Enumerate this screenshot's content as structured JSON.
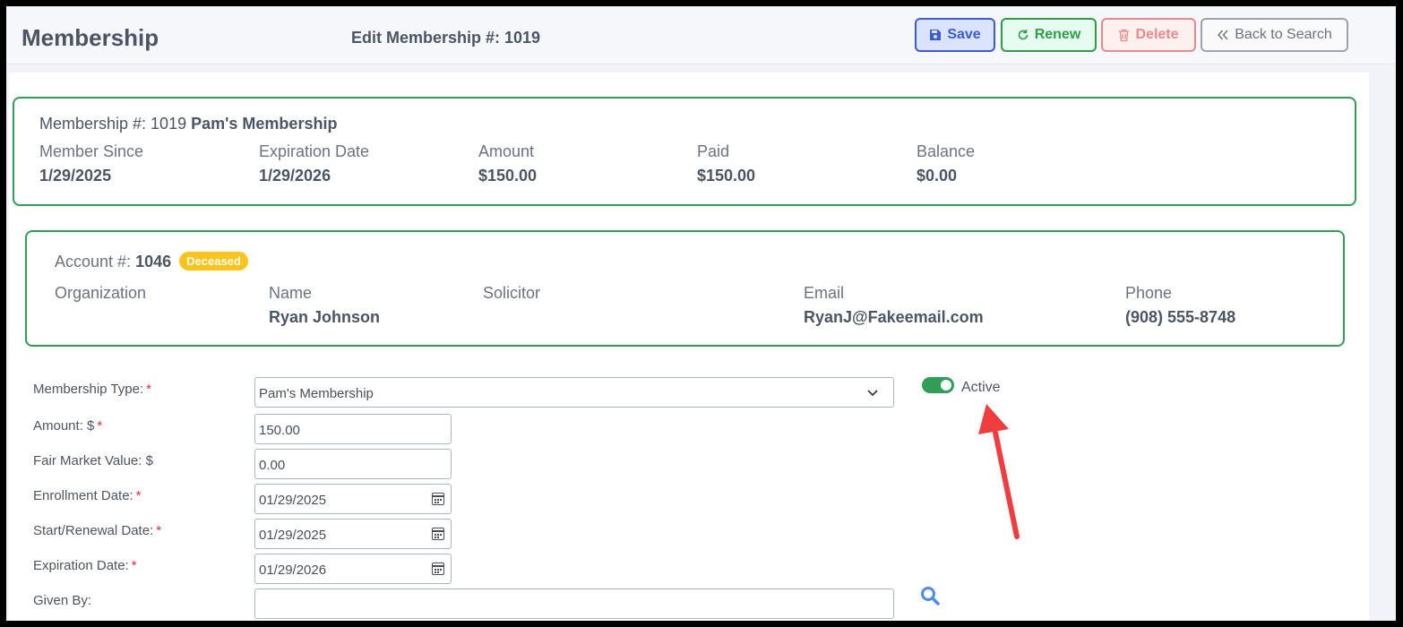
{
  "header": {
    "title": "Membership",
    "edit_title": "Edit Membership #: 1019",
    "buttons": {
      "save": "Save",
      "renew": "Renew",
      "delete": "Delete",
      "back": "Back to Search"
    }
  },
  "membership_card": {
    "prefix": "Membership #: 1019",
    "name": "Pam's Membership",
    "fields": [
      {
        "label": "Member Since",
        "value": "1/29/2025"
      },
      {
        "label": "Expiration Date",
        "value": "1/29/2026"
      },
      {
        "label": "Amount",
        "value": "$150.00"
      },
      {
        "label": "Paid",
        "value": "$150.00"
      },
      {
        "label": "Balance",
        "value": "$0.00"
      }
    ]
  },
  "account_card": {
    "prefix": "Account #:",
    "number": "1046",
    "badge": "Deceased",
    "fields": [
      {
        "label": "Organization",
        "value": ""
      },
      {
        "label": "Name",
        "value": "Ryan Johnson"
      },
      {
        "label": "Solicitor",
        "value": ""
      },
      {
        "label": "Email",
        "value": "RyanJ@Fakeemail.com"
      },
      {
        "label": "Phone",
        "value": "(908) 555-8748"
      }
    ]
  },
  "form": {
    "membership_type": {
      "label": "Membership Type:",
      "value": "Pam's Membership"
    },
    "amount": {
      "label": "Amount: $",
      "value": "150.00"
    },
    "fair_market_value": {
      "label": "Fair Market Value: $",
      "value": "0.00"
    },
    "enrollment_date": {
      "label": "Enrollment Date:",
      "value": "01/29/2025"
    },
    "start_renewal_date": {
      "label": "Start/Renewal Date:",
      "value": "01/29/2025"
    },
    "expiration_date": {
      "label": "Expiration Date:",
      "value": "01/29/2026"
    },
    "given_by": {
      "label": "Given By:",
      "value": ""
    },
    "required_marker": "*",
    "active_label": "Active",
    "active": true
  },
  "colors": {
    "card_border": "#2f9e57",
    "save": "#3b5bdb",
    "renew": "#2f9e44",
    "delete": "#e88a8a",
    "badge": "#fcc419",
    "arrow": "#f03e3e"
  },
  "icons": [
    "save-icon",
    "renew-icon",
    "trash-icon",
    "double-chevron-left-icon",
    "chevron-down-icon",
    "calendar-icon",
    "search-icon",
    "arrow-annotation"
  ]
}
